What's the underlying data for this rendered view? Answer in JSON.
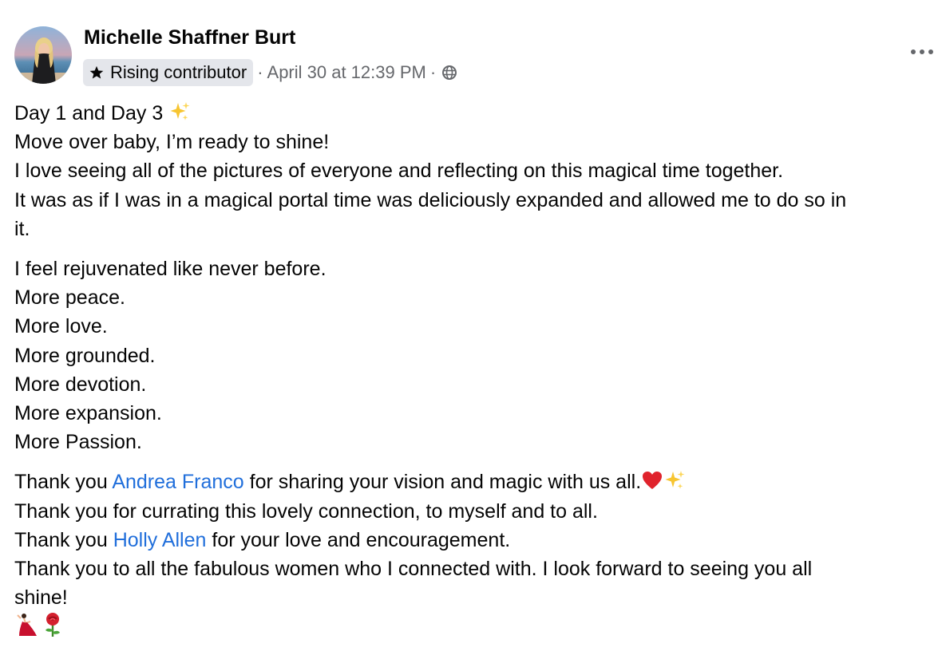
{
  "post": {
    "author": "Michelle Shaffner Burt",
    "badge": "Rising contributor",
    "separator": "·",
    "timestamp": "April 30 at 12:39 PM",
    "audience_icon": "globe-icon",
    "more_icon": "more-options-icon",
    "body": {
      "p1": {
        "l1": "Day 1 and Day 3 ",
        "l2": "Move over baby, I’m ready to shine!",
        "l3": "I love seeing all of the pictures of everyone and reflecting on this magical time together.",
        "l4": "It was as if I was in a magical portal time was deliciously expanded and allowed me to do so in",
        "l5": "it."
      },
      "p2": {
        "l1": "I feel rejuvenated like never before.",
        "l2": "More peace.",
        "l3": "More love.",
        "l4": "More grounded.",
        "l5": "More devotion.",
        "l6": "More expansion.",
        "l7": "More Passion."
      },
      "p3": {
        "l1a": "Thank you ",
        "l1_mention": "Andrea Franco",
        "l1b": " for sharing your vision and magic with us all.",
        "l2": "Thank you for currating this lovely connection, to myself and to all.",
        "l3a": "Thank you ",
        "l3_mention": "Holly Allen",
        "l3b": " for your love and encouragement.",
        "l4": "Thank you to all the fabulous women who I connected with. I look forward to seeing you all",
        "l5": "shine!"
      }
    },
    "emojis": {
      "day_line": "sparkles-icon",
      "thanks_line": [
        "red-heart-icon",
        "sparkles-icon"
      ],
      "closing": [
        "dancer-icon",
        "rose-icon"
      ]
    },
    "colors": {
      "link": "#216fdb",
      "secondary_text": "#65676b",
      "badge_bg": "#e4e6eb"
    }
  }
}
